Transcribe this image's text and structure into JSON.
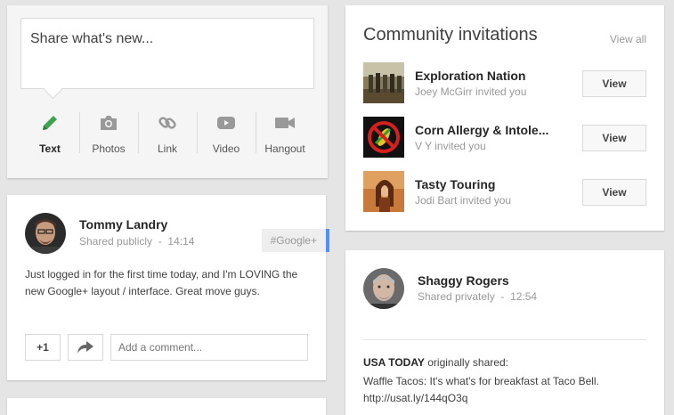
{
  "share": {
    "placeholder": "Share what's new...",
    "actions": [
      {
        "label": "Text",
        "icon": "pencil-icon"
      },
      {
        "label": "Photos",
        "icon": "camera-icon"
      },
      {
        "label": "Link",
        "icon": "link-icon"
      },
      {
        "label": "Video",
        "icon": "video-icon"
      },
      {
        "label": "Hangout",
        "icon": "hangout-icon"
      }
    ]
  },
  "post": {
    "author": "Tommy Landry",
    "visibility": "Shared publicly",
    "time": "14:14",
    "hashtag": "#Google+",
    "text": "Just logged in for the first time today, and I'm LOVING the new Google+ layout / interface. Great move guys.",
    "plus_one": "+1",
    "comment_placeholder": "Add a comment..."
  },
  "communities": {
    "title": "Community invitations",
    "view_all": "View all",
    "view_label": "View",
    "items": [
      {
        "name": "Exploration Nation",
        "invited": "Joey McGirr invited you"
      },
      {
        "name": "Corn Allergy & Intole...",
        "invited": "V Y invited you"
      },
      {
        "name": "Tasty Touring",
        "invited": "Jodi Bart invited you"
      }
    ]
  },
  "post2": {
    "author": "Shaggy Rogers",
    "visibility": "Shared privately",
    "time": "12:54",
    "reshare_source": "USA TODAY",
    "reshare_suffix": " originally shared:",
    "reshare_text": "Waffle Tacos: It's what's for breakfast at Taco Bell. http://usat.ly/144qO3q"
  },
  "colors": {
    "accent_blue": "#4d90fe",
    "pencil_green": "#3fa152",
    "background": "#e5e5e5"
  }
}
